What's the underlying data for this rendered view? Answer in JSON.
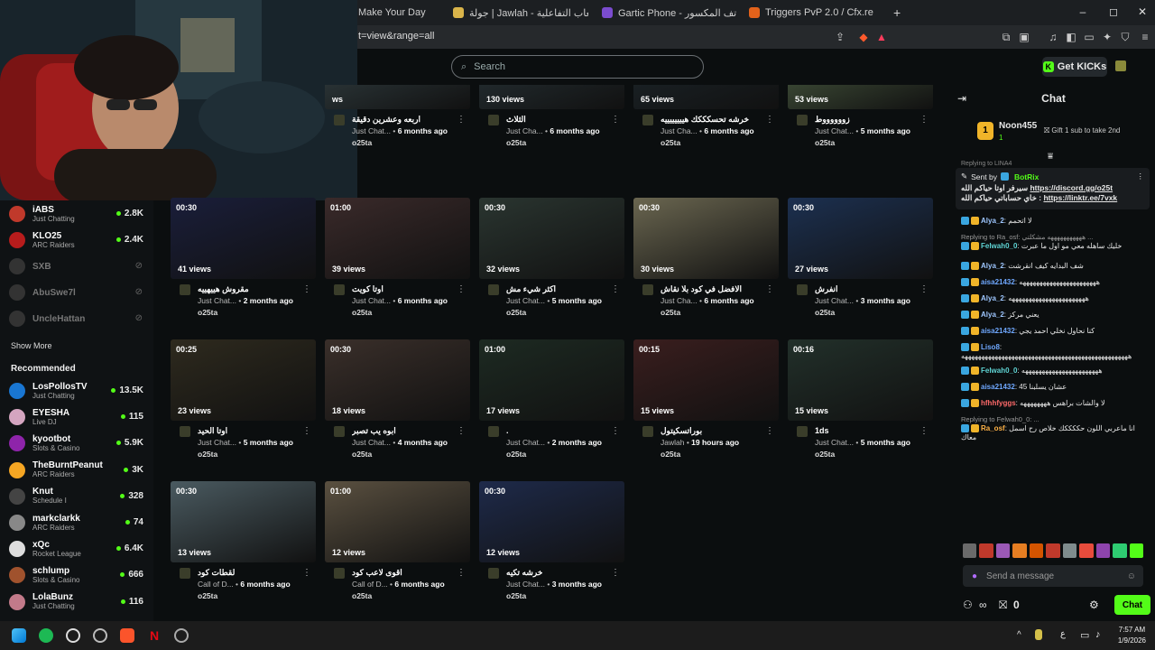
{
  "browser": {
    "tabs": [
      {
        "label": "Make Your Day",
        "color": "#2a2d30"
      },
      {
        "label": "جولة | Jawlah - منصة الألعاب التفاعلية",
        "color": "#d9b44a"
      },
      {
        "label": "Gartic Phone - لعبة الهواتف المكسور",
        "color": "#7b4ccf"
      },
      {
        "label": "Triggers PvP 2.0 / Cfx.re",
        "color": "#e2621b"
      }
    ],
    "new_tab": "+",
    "url": "t=view&range=all",
    "win_min": "–",
    "win_max": "◻",
    "win_close": "✕"
  },
  "header": {
    "search_placeholder": "Search",
    "get_kicks": "Get KICKs"
  },
  "sidebar": {
    "following": [
      {
        "name": "iABS",
        "category": "Just Chatting",
        "count": "2.8K",
        "color": "#c0392b",
        "online": true
      },
      {
        "name": "KLO25",
        "category": "ARC Raiders",
        "count": "2.4K",
        "color": "#b71c1c",
        "online": true
      },
      {
        "name": "SXB",
        "category": "",
        "count": "",
        "color": "#333",
        "online": false
      },
      {
        "name": "AbuSwe7l",
        "category": "",
        "count": "",
        "color": "#333",
        "online": false
      },
      {
        "name": "UncleHattan",
        "category": "",
        "count": "",
        "color": "#333",
        "online": false
      }
    ],
    "show_more": "Show More",
    "recommended_title": "Recommended",
    "recommended": [
      {
        "name": "LosPollosTV",
        "category": "Just Chatting",
        "count": "13.5K",
        "color": "#1976d2"
      },
      {
        "name": "EYESHA",
        "category": "Live DJ",
        "count": "115",
        "color": "#d4a5c0"
      },
      {
        "name": "kyootbot",
        "category": "Slots & Casino",
        "count": "5.9K",
        "color": "#8e24aa"
      },
      {
        "name": "TheBurntPeanut",
        "category": "ARC Raiders",
        "count": "3K",
        "color": "#f5a623"
      },
      {
        "name": "Knut",
        "category": "Schedule I",
        "count": "328",
        "color": "#444"
      },
      {
        "name": "markclarkk",
        "category": "ARC Raiders",
        "count": "74",
        "color": "#888"
      },
      {
        "name": "xQc",
        "category": "Rocket League",
        "count": "6.4K",
        "color": "#ddd"
      },
      {
        "name": "schlump",
        "category": "Slots & Casino",
        "count": "666",
        "color": "#a0522d"
      },
      {
        "name": "LolaBunz",
        "category": "Just Chatting",
        "count": "116",
        "color": "#c27a8a"
      }
    ]
  },
  "clips": [
    {
      "views": "ws",
      "duration": "",
      "title": "اربعه وعشرين دقيقة",
      "category": "Just Chat...",
      "age": "6 months ago",
      "channel": "o25ta",
      "bg": "#3a4a4e"
    },
    {
      "views": "130 views",
      "duration": "",
      "title": "الثلاث",
      "category": "Just Cha...",
      "age": "6 months ago",
      "channel": "o25ta",
      "bg": "#2c3a3f"
    },
    {
      "views": "65 views",
      "duration": "",
      "title": "خرشه تحسكككك هييييييييه",
      "category": "Just Cha...",
      "age": "6 months ago",
      "channel": "o25ta",
      "bg": "#1f2a30"
    },
    {
      "views": "53 views",
      "duration": "",
      "title": "زووووووط",
      "category": "Just Chat...",
      "age": "5 months ago",
      "channel": "o25ta",
      "bg": "#556a4a"
    },
    {
      "views": "41 views",
      "duration": "00:30",
      "title": "مقروش هييهييه",
      "category": "Just Chat...",
      "age": "2 months ago",
      "channel": "o25ta",
      "bg": "#1a1e3a"
    },
    {
      "views": "39 views",
      "duration": "01:00",
      "title": "اوتا كويت",
      "category": "Just Chat...",
      "age": "6 months ago",
      "channel": "o25ta",
      "bg": "#3a2a2a"
    },
    {
      "views": "32 views",
      "duration": "00:30",
      "title": "اكثر شيء مش",
      "category": "Just Chat...",
      "age": "5 months ago",
      "channel": "o25ta",
      "bg": "#2a3530"
    },
    {
      "views": "30 views",
      "duration": "00:30",
      "title": "الافضل في كود بلا نقاش",
      "category": "Just Cha...",
      "age": "6 months ago",
      "channel": "o25ta",
      "bg": "#6a6650"
    },
    {
      "views": "27 views",
      "duration": "00:30",
      "title": "انفرش",
      "category": "Just Chat...",
      "age": "3 months ago",
      "channel": "o25ta",
      "bg": "#1c3050"
    },
    {
      "views": "23 views",
      "duration": "00:25",
      "title": "اوتا الحيد",
      "category": "Just Chat...",
      "age": "5 months ago",
      "channel": "o25ta",
      "bg": "#2e2a1e"
    },
    {
      "views": "18 views",
      "duration": "00:30",
      "title": "ابوه يب تصبر",
      "category": "Just Chat...",
      "age": "4 months ago",
      "channel": "o25ta",
      "bg": "#3a2f2a"
    },
    {
      "views": "17 views",
      "duration": "01:00",
      "title": ".",
      "category": "Just Chat...",
      "age": "2 months ago",
      "channel": "o25ta",
      "bg": "#1d2a22"
    },
    {
      "views": "15 views",
      "duration": "00:15",
      "title": "بوراتسكيتول",
      "category": "Jawlah",
      "age": "19 hours ago",
      "channel": "o25ta",
      "bg": "#3a1e1e"
    },
    {
      "views": "15 views",
      "duration": "00:16",
      "title": "1ds",
      "category": "Just Chat...",
      "age": "5 months ago",
      "channel": "o25ta",
      "bg": "#22302a"
    },
    {
      "views": "13 views",
      "duration": "00:30",
      "title": "لقطات كود",
      "category": "Call of D...",
      "age": "6 months ago",
      "channel": "o25ta",
      "bg": "#4a5a60"
    },
    {
      "views": "12 views",
      "duration": "01:00",
      "title": "اقوى لاعب كود",
      "category": "Call of D...",
      "age": "6 months ago",
      "channel": "o25ta",
      "bg": "#5a5040"
    },
    {
      "views": "12 views",
      "duration": "00:30",
      "title": "خرشه تكيه",
      "category": "Just Chat...",
      "age": "3 months ago",
      "channel": "o25ta",
      "bg": "#1e2a4a"
    }
  ],
  "chat": {
    "title": "Chat",
    "gifter": {
      "name": "Noon455",
      "rank": "1",
      "count": "1"
    },
    "gift_cta": "Gift 1 sub to take 2nd",
    "pinned": {
      "sent_by_label": "Sent by",
      "sender": "BotRix",
      "line1_prefix": "سيرفر اوتا حياكم الله",
      "link1": "https://discord.gg/o25t",
      "line2_prefix": "خاي حساباتي حياكم الله :",
      "link2": "https://linktr.ee/7vxk",
      "behind": "Replying to LINA4"
    },
    "messages": [
      {
        "user": "Alya_2",
        "text": "لا اتحمم",
        "color": "#9ec7ff"
      },
      {
        "reply": "Replying to Ra_osf: هههههههههههه مشكلتي ...",
        "user": "Felwah0_0",
        "text": "خليك ساهله معي مو اول ما عبرت",
        "color": "#5fd4d4"
      },
      {
        "user": "Alya_2",
        "text": "شف البدايه كيف انقرشت",
        "color": "#9ec7ff"
      },
      {
        "user": "aisa21432",
        "text": "هههههههههههههههههههههههه",
        "color": "#6fa8ff"
      },
      {
        "user": "Alya_2",
        "text": "هههههههههههههههههههههههه",
        "color": "#9ec7ff"
      },
      {
        "user": "Alya_2",
        "text": "يعني مركز",
        "color": "#9ec7ff"
      },
      {
        "user": "aisa21432",
        "text": "كنا نحاول نخلي احمد يجي",
        "color": "#6fa8ff"
      },
      {
        "user": "Liso8",
        "text": "ههههههههههههههههههههههههههههههههههههههههههههههههههه",
        "color": "#6fa8ff"
      },
      {
        "user": "Felwah0_0",
        "text": "هههههههههههههههههههههههه",
        "color": "#5fd4d4"
      },
      {
        "user": "aisa21432",
        "text": "عشان يسلبنا 45",
        "color": "#6fa8ff"
      },
      {
        "user": "hfhhfyggs",
        "text": "لا والشات براهس ههههههههه",
        "color": "#ff6a6a"
      },
      {
        "reply": "Replying to Felwah0_0: ...",
        "user": "Ra_osf",
        "text": "انا ماعربي اللون حككككك خلاص رح اسمل معاك",
        "color": "#ffb347"
      }
    ],
    "send_placeholder": "Send a message",
    "kicks_count": "0",
    "chat_button": "Chat"
  },
  "taskbar": {
    "time": "7:57 AM",
    "date": "1/9/2026",
    "lang": "ع"
  }
}
